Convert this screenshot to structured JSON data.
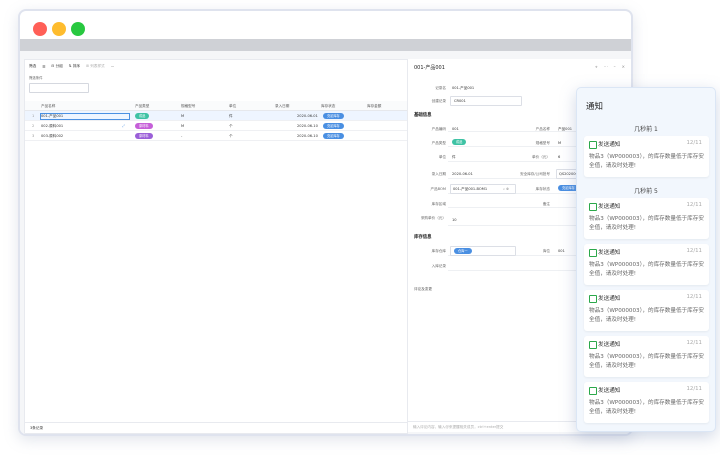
{
  "window": {
    "traffic": [
      "#ff5f57",
      "#febc2e",
      "#28c840"
    ]
  },
  "toolbar": {
    "items": [
      "筛选",
      "☰",
      "⊟ 分组",
      "⇅ 排序",
      "⊞ 列表样式",
      "⋯"
    ],
    "search_label": "产品名称",
    "filter_label": "筛选条件"
  },
  "table": {
    "columns": [
      "产品名称",
      "产品类型",
      "规格型号",
      "单位",
      "录入日期",
      "库存状态",
      "库存金额"
    ],
    "rows": [
      {
        "num": "1",
        "name": "001-产品001",
        "type": "成品",
        "type_color": "#3ec2a4",
        "spec": "M",
        "unit": "件",
        "date": "2020-06-01",
        "status": "充足库存"
      },
      {
        "num": "2",
        "name": "002-原料001",
        "type": "原材料",
        "type_color": "#c55fd8",
        "spec": "M",
        "unit": "个",
        "date": "2020-06-10",
        "status": "充足库存"
      },
      {
        "num": "3",
        "name": "003-原料002",
        "type": "原材料",
        "type_color": "#9b5fd8",
        "spec": "-",
        "unit": "个",
        "date": "2020-06-10",
        "status": "充足库存"
      }
    ],
    "footer": "3条记录"
  },
  "detail": {
    "title": "001-产品001",
    "record_name_label": "记录名",
    "record_name": "001-产品001",
    "creator_label": "创建记录",
    "creator": "CR001",
    "section_basic": "基础信息",
    "fields": [
      {
        "l1": "产品编码",
        "v1": "001",
        "l2": "产品名称",
        "v2": "产品001"
      },
      {
        "l1": "产品类型",
        "v1": "成品",
        "l2": "规格型号",
        "v2": "M"
      },
      {
        "l1": "单位",
        "v1": "件",
        "l2": "单价（元）",
        "v2": "6"
      },
      {
        "l1": "录入日期",
        "v1": "2020-06-01",
        "l2": "安全库存/公司批号",
        "v2": "QS20200601001"
      },
      {
        "l1": "产品BOM",
        "v1": "001-产品001-BOM1",
        "l2": "库存状态",
        "v2": "充足库存"
      },
      {
        "l1": "库存区域",
        "v1": "",
        "l2": "备注",
        "v2": ""
      },
      {
        "l1": "采购单价（元）",
        "v1": "10",
        "l2": "",
        "v2": ""
      }
    ],
    "section_stock": "库存信息",
    "stock_fields": [
      {
        "l1": "库存仓库",
        "v1": "仓库一",
        "l2": "库位",
        "v2": "001"
      },
      {
        "l1": "入库记录",
        "v1": "",
        "l2": "",
        "v2": ""
      }
    ],
    "comment_label": "评论及变更",
    "comment_placeholder": "输入评论内容，输入@来提醒相关成员，ctrl+enter提交"
  },
  "notifications": {
    "title": "通知",
    "groups": [
      {
        "label": "几秒前 1",
        "items": [
          {
            "title": "发送通知",
            "date": "12/11",
            "body": "物品3（WP000003），的库存数量低于库存安全值，请及时处理!"
          }
        ]
      },
      {
        "label": "几秒前 5",
        "items": [
          {
            "title": "发送通知",
            "date": "12/11",
            "body": "物品3（WP000003），的库存数量低于库存安全值，请及时处理!"
          },
          {
            "title": "发送通知",
            "date": "12/11",
            "body": "物品3（WP000003），的库存数量低于库存安全值，请及时处理!"
          },
          {
            "title": "发送通知",
            "date": "12/11",
            "body": "物品3（WP000003），的库存数量低于库存安全值，请及时处理!"
          },
          {
            "title": "发送通知",
            "date": "12/11",
            "body": "物品3（WP000003），的库存数量低于库存安全值，请及时处理!"
          },
          {
            "title": "发送通知",
            "date": "12/11",
            "body": "物品3（WP000003），的库存数量低于库存安全值，请及时处理!"
          }
        ]
      }
    ]
  }
}
